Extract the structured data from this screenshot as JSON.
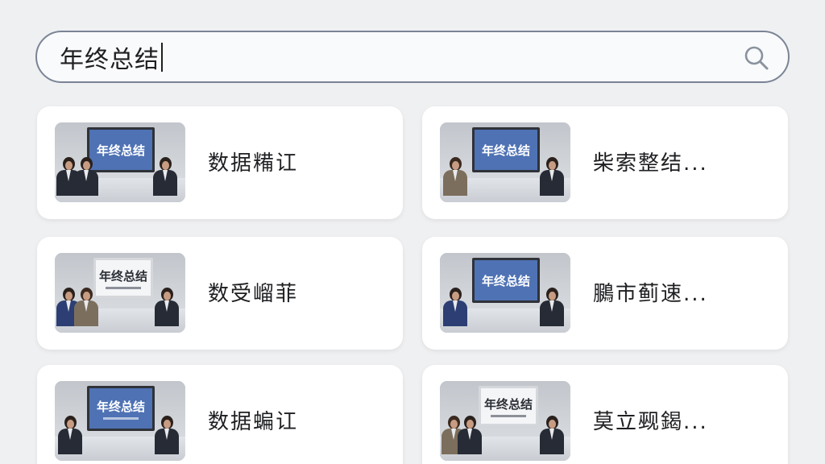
{
  "search": {
    "query": "年终总结",
    "icon": "search-icon"
  },
  "results": [
    {
      "title": "数据糒讧",
      "thumbnail_text": "年终总结"
    },
    {
      "title": "柴索整结...",
      "thumbnail_text": "年终总结"
    },
    {
      "title": "数受嵧菲",
      "thumbnail_text": "年终总结"
    },
    {
      "title": "鵩市蓟速...",
      "thumbnail_text": "年终总结"
    },
    {
      "title": "数据蝙讧",
      "thumbnail_text": "年终总结"
    },
    {
      "title": "莫立觋鍻...",
      "thumbnail_text": "年终总结"
    }
  ],
  "colors": {
    "background": "#eff0f2",
    "card": "#ffffff",
    "search_border": "#7a8495",
    "slide_blue": "#4f72b4"
  }
}
